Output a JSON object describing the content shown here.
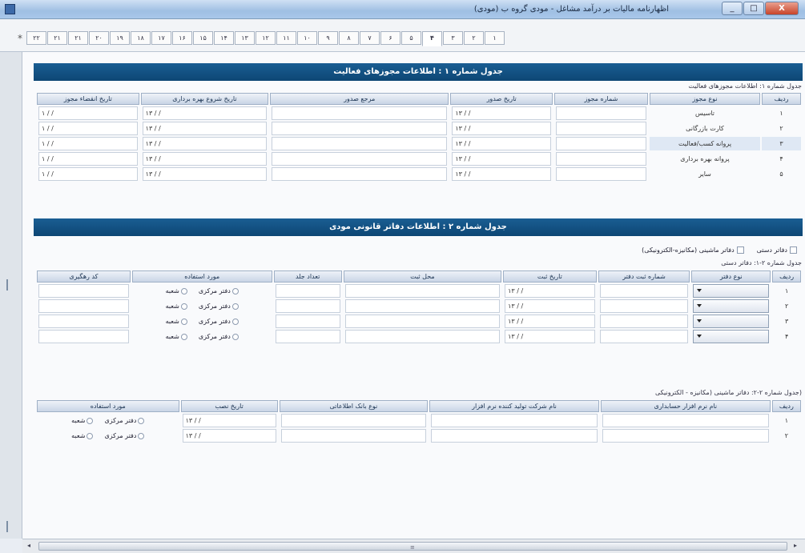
{
  "window": {
    "title": "اظهارنامه مالیات بر درآمد مشاغل - مودی گروه ب (مودی)",
    "minimize": "_",
    "maximize": "□",
    "close": "X"
  },
  "tabs": {
    "lead": "*",
    "items": [
      "۲۲",
      "۲۱",
      "۲۱",
      "۲۰",
      "۱۹",
      "۱۸",
      "۱۷",
      "۱۶",
      "۱۵",
      "۱۴",
      "۱۳",
      "۱۲",
      "۱۱",
      "۱۰",
      "۹",
      "۸",
      "۷",
      "۶",
      "۵",
      "۴",
      "۳",
      "۲",
      "۱"
    ],
    "active_index": 19
  },
  "table1": {
    "banner": "جدول شماره ۱ : اطلاعات مجوزهای فعالیت",
    "caption": "جدول شماره ۱: اطلاعات مجوزهای فعالیت",
    "headers": [
      "ردیف",
      "نوع مجوز",
      "شماره مجوز",
      "تاریخ صدور",
      "مرجع صدور",
      "تاریخ شروع بهره برداری",
      "تاریخ انقضاء مجوز"
    ],
    "rows": [
      {
        "num": "۱",
        "type": "تاسیس",
        "issue_date": "۱۳ / /",
        "start_date": "۱۳ / /",
        "expire_date": "۱ / /"
      },
      {
        "num": "۲",
        "type": "کارت بازرگانی",
        "issue_date": "۱۳ / /",
        "start_date": "۱۳ / /",
        "expire_date": "۱ / /"
      },
      {
        "num": "۳",
        "type": "پروانه کسب/فعالیت",
        "issue_date": "۱۳ / /",
        "start_date": "۱۳ / /",
        "expire_date": "۱ / /"
      },
      {
        "num": "۴",
        "type": "پروانه بهره برداری",
        "issue_date": "۱۳ / /",
        "start_date": "۱۳ / /",
        "expire_date": "۱ / /"
      },
      {
        "num": "۵",
        "type": "سایر",
        "issue_date": "۱۳ / /",
        "start_date": "۱۳ / /",
        "expire_date": "۱ / /"
      }
    ]
  },
  "table2": {
    "banner": "جدول شماره ۲ : اطلاعات دفاتر قانونی مودی",
    "check_manual": "دفاتر دستی",
    "check_machine": "دفاتر ماشینی (مکانیزه-الکترونیکی)",
    "caption1": "جدول شماره ۲-۱: دفاتر دستی",
    "headers1": [
      "ردیف",
      "نوع دفتر",
      "شماره ثبت دفتر",
      "تاریخ ثبت",
      "محل ثبت",
      "تعداد جلد",
      "مورد استفاده",
      "کد رهگیری"
    ],
    "radio_central": "دفتر مرکزی",
    "radio_branch": "شعبه",
    "rows1": [
      {
        "num": "۱",
        "reg_date": "۱۳ / /"
      },
      {
        "num": "۲",
        "reg_date": "۱۳ / /"
      },
      {
        "num": "۳",
        "reg_date": "۱۳ / /"
      },
      {
        "num": "۴",
        "reg_date": "۱۳ / /"
      }
    ],
    "caption2": "(جدول شماره ۲-۲: دفاتر ماشینی (مکانیزه - الکترونیکی",
    "headers2": [
      "ردیف",
      "نام نرم افزار حسابداری",
      "نام شرکت تولید کننده نرم افزار",
      "نوع بانک اطلاعاتی",
      "تاریخ نصب",
      "مورد استفاده"
    ],
    "rows2": [
      {
        "num": "۱",
        "install_date": "۱۳ / /"
      },
      {
        "num": "۲",
        "install_date": "۱۳ / /"
      }
    ]
  }
}
